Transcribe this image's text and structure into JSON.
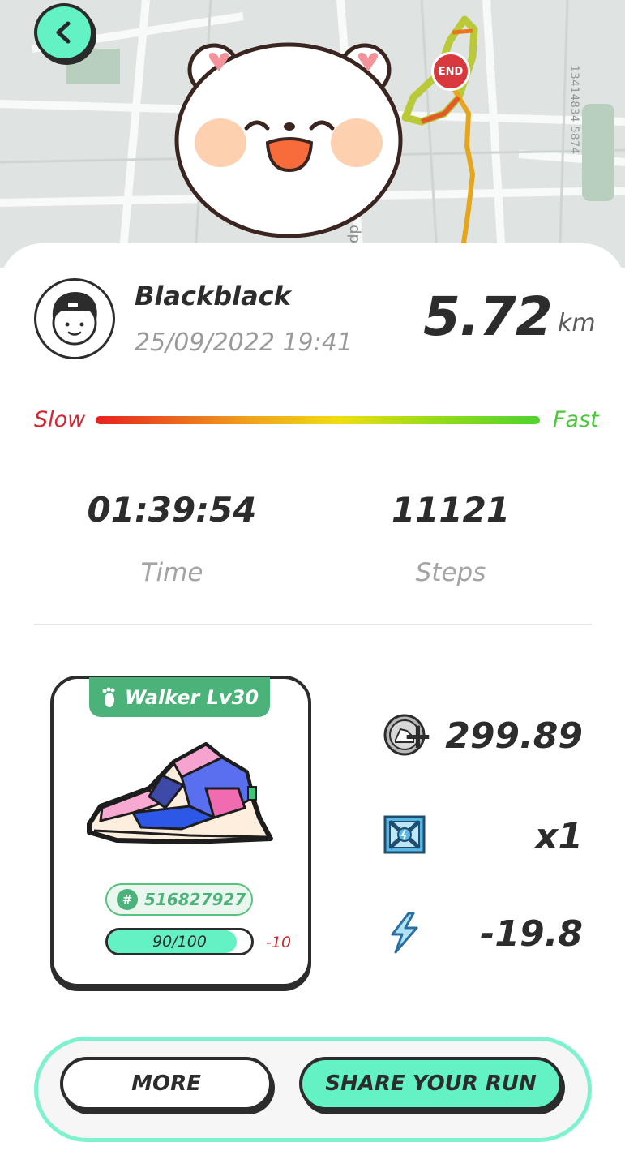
{
  "map": {
    "end_label": "END",
    "map_id": "13414834 5874",
    "street_text": "dp"
  },
  "profile": {
    "username": "Blackblack",
    "datetime": "25/09/2022 19:41"
  },
  "run": {
    "distance": "5.72",
    "distance_unit": "km",
    "speed_legend": {
      "slow": "Slow",
      "fast": "Fast"
    },
    "stats": [
      {
        "value": "01:39:54",
        "label": "Time"
      },
      {
        "value": "11121",
        "label": "Steps"
      }
    ]
  },
  "sneaker": {
    "tag": "Walker Lv30",
    "id_symbol": "#",
    "id": "516827927",
    "durability_text": "90/100",
    "durability_fraction": 0.9,
    "durability_delta": "-10"
  },
  "rewards": [
    {
      "icon": "coin-icon",
      "value": "+ 299.89"
    },
    {
      "icon": "mystery-box-icon",
      "value": "x1"
    },
    {
      "icon": "energy-bolt-icon",
      "value": "-19.8"
    }
  ],
  "actions": {
    "more": "MORE",
    "share": "SHARE YOUR RUN"
  },
  "colors": {
    "accent": "#62f2c4",
    "tag_green": "#4bb27a",
    "slow_red": "#d7252f",
    "fast_green": "#4dc93c"
  }
}
